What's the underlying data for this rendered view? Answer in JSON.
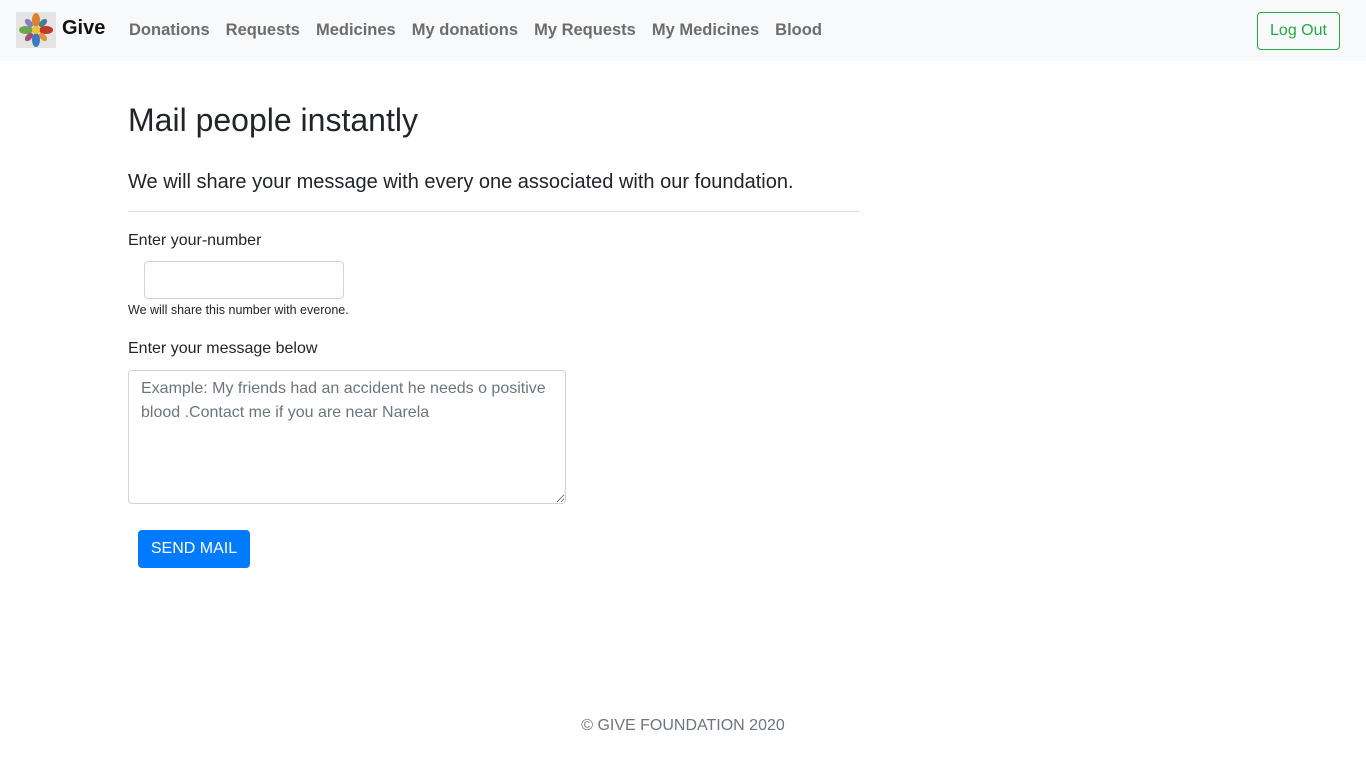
{
  "navbar": {
    "brand": "Give",
    "links": [
      "Donations",
      "Requests",
      "Medicines",
      "My donations",
      "My Requests",
      "My Medicines",
      "Blood"
    ],
    "logout_label": "Log Out"
  },
  "main": {
    "title": "Mail people instantly",
    "lead": "We will share your message with every one associated with our foundation.",
    "number_label": "Enter your-number",
    "number_value": "",
    "number_help": "We will share this number with everone.",
    "message_label": "Enter your message below",
    "message_placeholder": "Example: My friends had an accident he needs o positive blood .Contact me if you are near Narela",
    "message_value": "",
    "send_label": "SEND MAIL"
  },
  "footer": {
    "text": "© GIVE FOUNDATION 2020"
  },
  "colors": {
    "navbar_bg": "#f8f9fa",
    "logout_accent": "#28a745",
    "primary_button": "#007bff"
  }
}
